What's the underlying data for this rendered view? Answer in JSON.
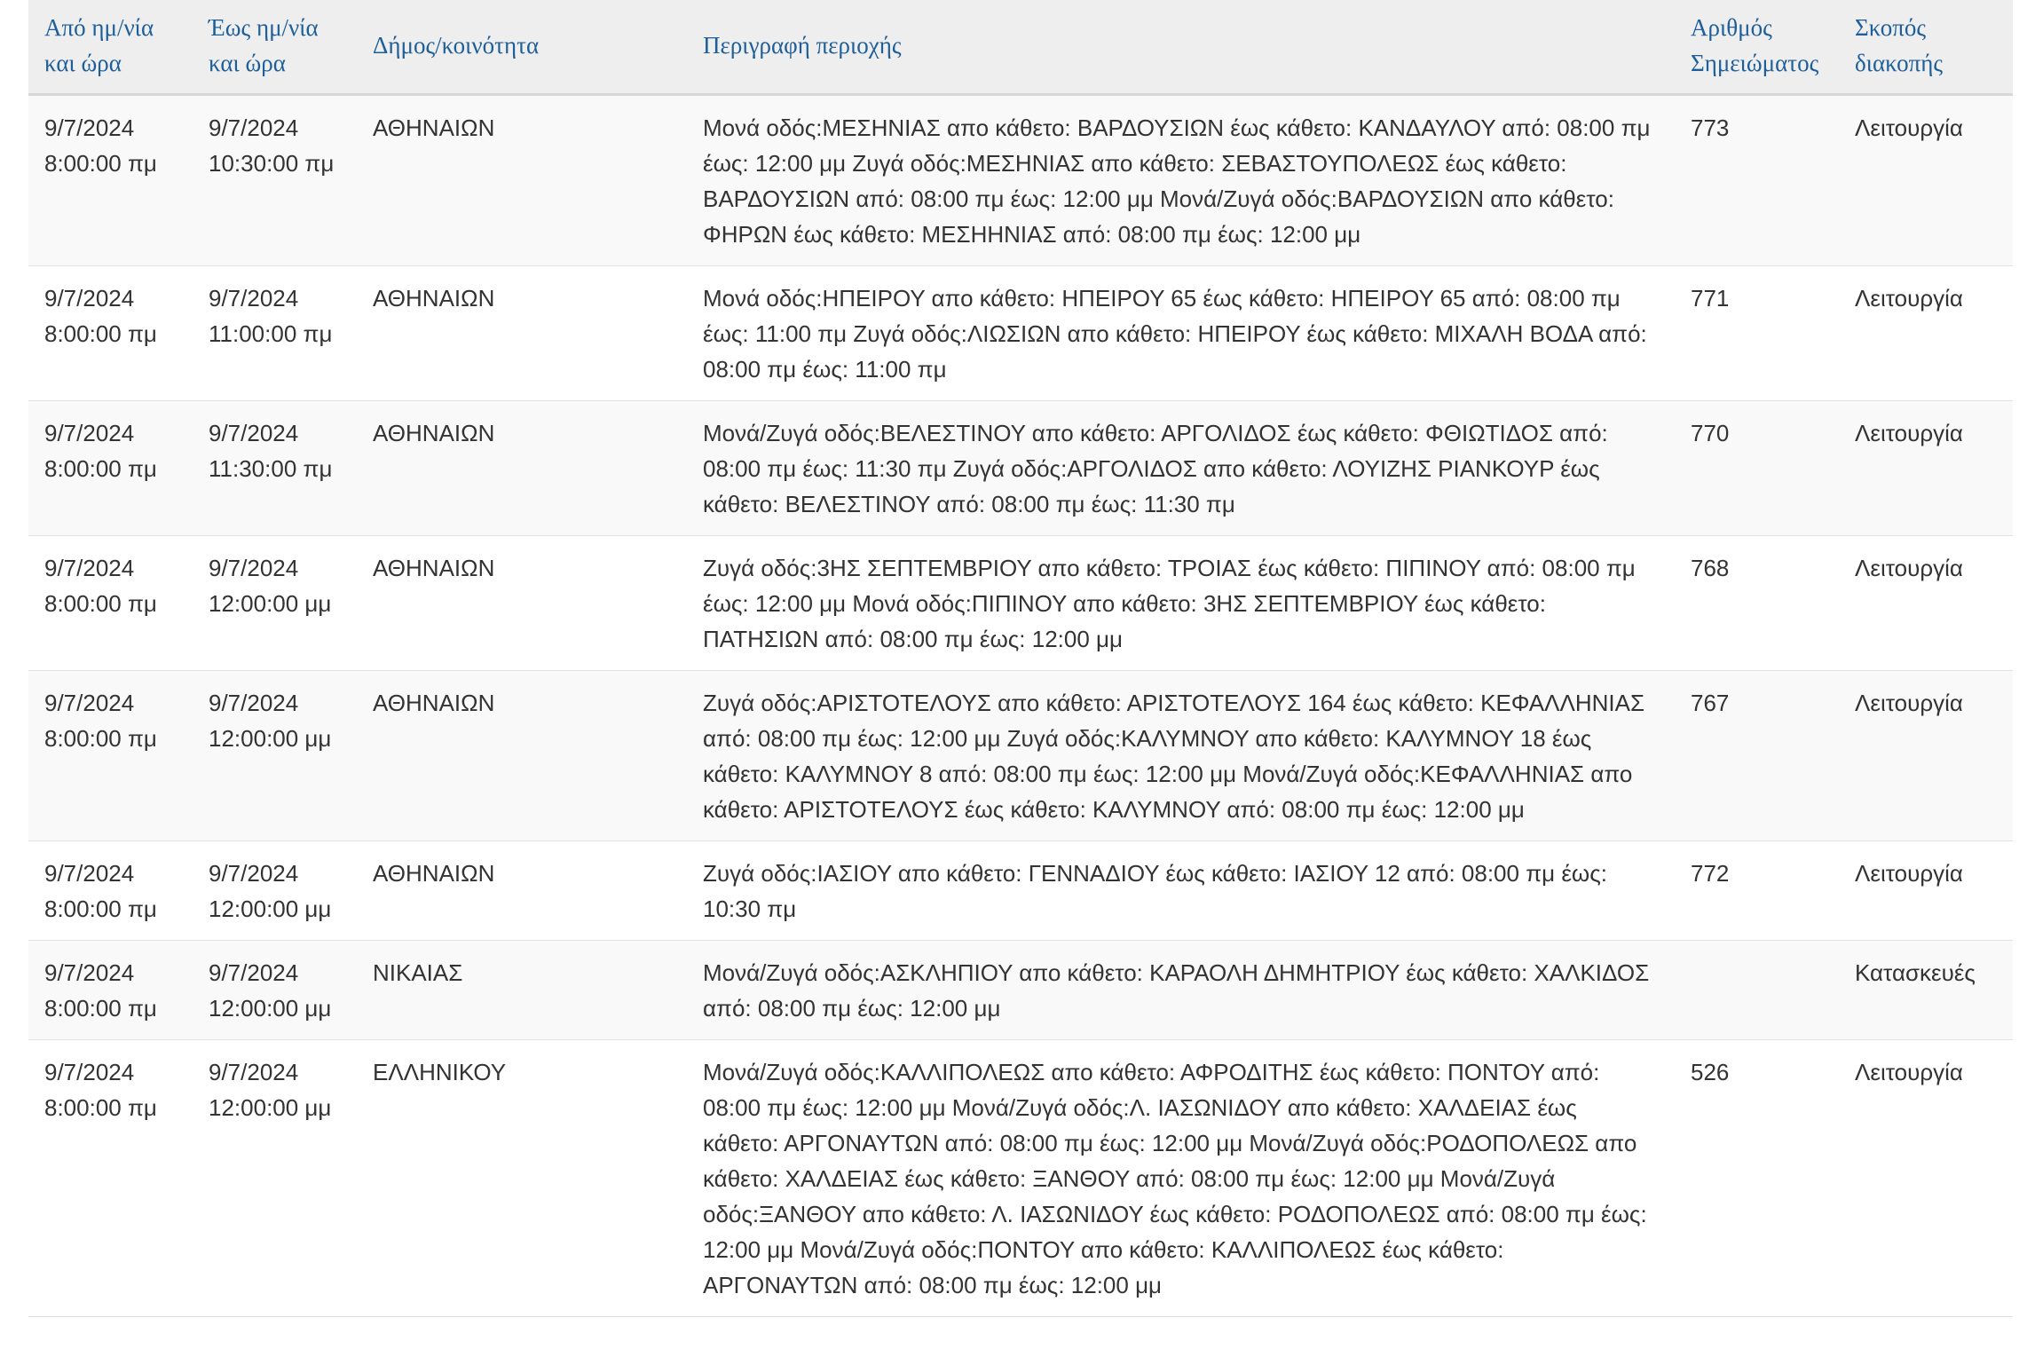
{
  "table": {
    "headers": {
      "from": "Από ημ/νία και ώρα",
      "to": "Έως ημ/νία και ώρα",
      "municipality": "Δήμος/κοινότητα",
      "description": "Περιγραφή περιοχής",
      "notice_number": "Αριθμός Σημειώματος",
      "purpose": "Σκοπός διακοπής"
    },
    "rows": [
      {
        "from_date": "9/7/2024",
        "from_time": "8:00:00 πμ",
        "to_date": "9/7/2024",
        "to_time": "10:30:00 πμ",
        "municipality": "ΑΘΗΝΑΙΩΝ",
        "description": "Μονά οδός:ΜΕΣΗΝΙΑΣ απο κάθετο: ΒΑΡΔΟΥΣΙΩΝ έως κάθετο: ΚΑΝΔΑΥΛΟΥ από: 08:00 πμ έως: 12:00 μμ Ζυγά οδός:ΜΕΣΗΝΙΑΣ απο κάθετο: ΣΕΒΑΣΤΟΥΠΟΛΕΩΣ έως κάθετο: ΒΑΡΔΟΥΣΙΩΝ από: 08:00 πμ έως: 12:00 μμ Μονά/Ζυγά οδός:ΒΑΡΔΟΥΣΙΩΝ απο κάθετο: ΦΗΡΩΝ έως κάθετο: ΜΕΣΗΗΝΙΑΣ από: 08:00 πμ έως: 12:00 μμ",
        "notice_number": "773",
        "purpose": "Λειτουργία"
      },
      {
        "from_date": "9/7/2024",
        "from_time": "8:00:00 πμ",
        "to_date": "9/7/2024",
        "to_time": "11:00:00 πμ",
        "municipality": "ΑΘΗΝΑΙΩΝ",
        "description": "Μονά οδός:ΗΠΕΙΡΟΥ απο κάθετο: ΗΠΕΙΡΟΥ 65 έως κάθετο: ΗΠΕΙΡΟΥ 65 από: 08:00 πμ έως: 11:00 πμ Ζυγά οδός:ΛΙΩΣΙΩΝ απο κάθετο: ΗΠΕΙΡΟΥ έως κάθετο: ΜΙΧΑΛΗ ΒΟΔΑ από: 08:00 πμ έως: 11:00 πμ",
        "notice_number": "771",
        "purpose": "Λειτουργία"
      },
      {
        "from_date": "9/7/2024",
        "from_time": "8:00:00 πμ",
        "to_date": "9/7/2024",
        "to_time": "11:30:00 πμ",
        "municipality": "ΑΘΗΝΑΙΩΝ",
        "description": "Μονά/Ζυγά οδός:ΒΕΛΕΣΤΙΝΟΥ απο κάθετο: ΑΡΓΟΛΙΔΟΣ έως κάθετο: ΦΘΙΩΤΙΔΟΣ από: 08:00 πμ έως: 11:30 πμ Ζυγά οδός:ΑΡΓΟΛΙΔΟΣ απο κάθετο: ΛΟΥΙΖΗΣ ΡΙΑΝΚΟΥΡ έως κάθετο: ΒΕΛΕΣΤΙΝΟΥ από: 08:00 πμ έως: 11:30 πμ",
        "notice_number": "770",
        "purpose": "Λειτουργία"
      },
      {
        "from_date": "9/7/2024",
        "from_time": "8:00:00 πμ",
        "to_date": "9/7/2024",
        "to_time": "12:00:00 μμ",
        "municipality": "ΑΘΗΝΑΙΩΝ",
        "description": "Ζυγά οδός:3ΗΣ ΣΕΠΤΕΜΒΡΙΟΥ απο κάθετο: ΤΡΟΙΑΣ έως κάθετο: ΠΙΠΙΝΟΥ από: 08:00 πμ έως: 12:00 μμ Μονά οδός:ΠΙΠΙΝΟΥ απο κάθετο: 3ΗΣ ΣΕΠΤΕΜΒΡΙΟΥ έως κάθετο: ΠΑΤΗΣΙΩΝ από: 08:00 πμ έως: 12:00 μμ",
        "notice_number": "768",
        "purpose": "Λειτουργία"
      },
      {
        "from_date": "9/7/2024",
        "from_time": "8:00:00 πμ",
        "to_date": "9/7/2024",
        "to_time": "12:00:00 μμ",
        "municipality": "ΑΘΗΝΑΙΩΝ",
        "description": "Ζυγά οδός:ΑΡΙΣΤΟΤΕΛΟΥΣ απο κάθετο: ΑΡΙΣΤΟΤΕΛΟΥΣ 164 έως κάθετο: ΚΕΦΑΛΛΗΝΙΑΣ από: 08:00 πμ έως: 12:00 μμ Ζυγά οδός:ΚΑΛΥΜΝΟΥ απο κάθετο: ΚΑΛΥΜΝΟΥ 18 έως κάθετο: ΚΑΛΥΜΝΟΥ 8 από: 08:00 πμ έως: 12:00 μμ Μονά/Ζυγά οδός:ΚΕΦΑΛΛΗΝΙΑΣ απο κάθετο: ΑΡΙΣΤΟΤΕΛΟΥΣ έως κάθετο: ΚΑΛΥΜΝΟΥ από: 08:00 πμ έως: 12:00 μμ",
        "notice_number": "767",
        "purpose": "Λειτουργία"
      },
      {
        "from_date": "9/7/2024",
        "from_time": "8:00:00 πμ",
        "to_date": "9/7/2024",
        "to_time": "12:00:00 μμ",
        "municipality": "ΑΘΗΝΑΙΩΝ",
        "description": "Ζυγά οδός:ΙΑΣΙΟΥ απο κάθετο: ΓΕΝΝΑΔΙΟΥ έως κάθετο: ΙΑΣΙΟΥ 12 από: 08:00 πμ έως: 10:30 πμ",
        "notice_number": "772",
        "purpose": "Λειτουργία"
      },
      {
        "from_date": "9/7/2024",
        "from_time": "8:00:00 πμ",
        "to_date": "9/7/2024",
        "to_time": "12:00:00 μμ",
        "municipality": "ΝΙΚΑΙΑΣ",
        "description": "Μονά/Ζυγά οδός:ΑΣΚΛΗΠΙΟΥ απο κάθετο: ΚΑΡΑΟΛΗ ΔΗΜΗΤΡΙΟΥ έως κάθετο: ΧΑΛΚΙΔΟΣ από: 08:00 πμ έως: 12:00 μμ",
        "notice_number": "",
        "purpose": "Κατασκευές"
      },
      {
        "from_date": "9/7/2024",
        "from_time": "8:00:00 πμ",
        "to_date": "9/7/2024",
        "to_time": "12:00:00 μμ",
        "municipality": "ΕΛΛΗΝΙΚΟΥ",
        "description": "Μονά/Ζυγά οδός:ΚΑΛΛΙΠΟΛΕΩΣ απο κάθετο: ΑΦΡΟΔΙΤΗΣ έως κάθετο: ΠΟΝΤΟΥ από: 08:00 πμ έως: 12:00 μμ Μονά/Ζυγά οδός:Λ. ΙΑΣΩΝΙΔΟΥ απο κάθετο: ΧΑΛΔΕΙΑΣ έως κάθετο: ΑΡΓΟΝΑΥΤΩΝ από: 08:00 πμ έως: 12:00 μμ Μονά/Ζυγά οδός:ΡΟΔΟΠΟΛΕΩΣ απο κάθετο: ΧΑΛΔΕΙΑΣ έως κάθετο: ΞΑΝΘΟΥ από: 08:00 πμ έως: 12:00 μμ Μονά/Ζυγά οδός:ΞΑΝΘΟΥ απο κάθετο: Λ. ΙΑΣΩΝΙΔΟΥ έως κάθετο: ΡΟΔΟΠΟΛΕΩΣ από: 08:00 πμ έως: 12:00 μμ Μονά/Ζυγά οδός:ΠΟΝΤΟΥ απο κάθετο: ΚΑΛΛΙΠΟΛΕΩΣ έως κάθετο: ΑΡΓΟΝΑΥΤΩΝ από: 08:00 πμ έως: 12:00 μμ",
        "notice_number": "526",
        "purpose": "Λειτουργία"
      }
    ]
  }
}
